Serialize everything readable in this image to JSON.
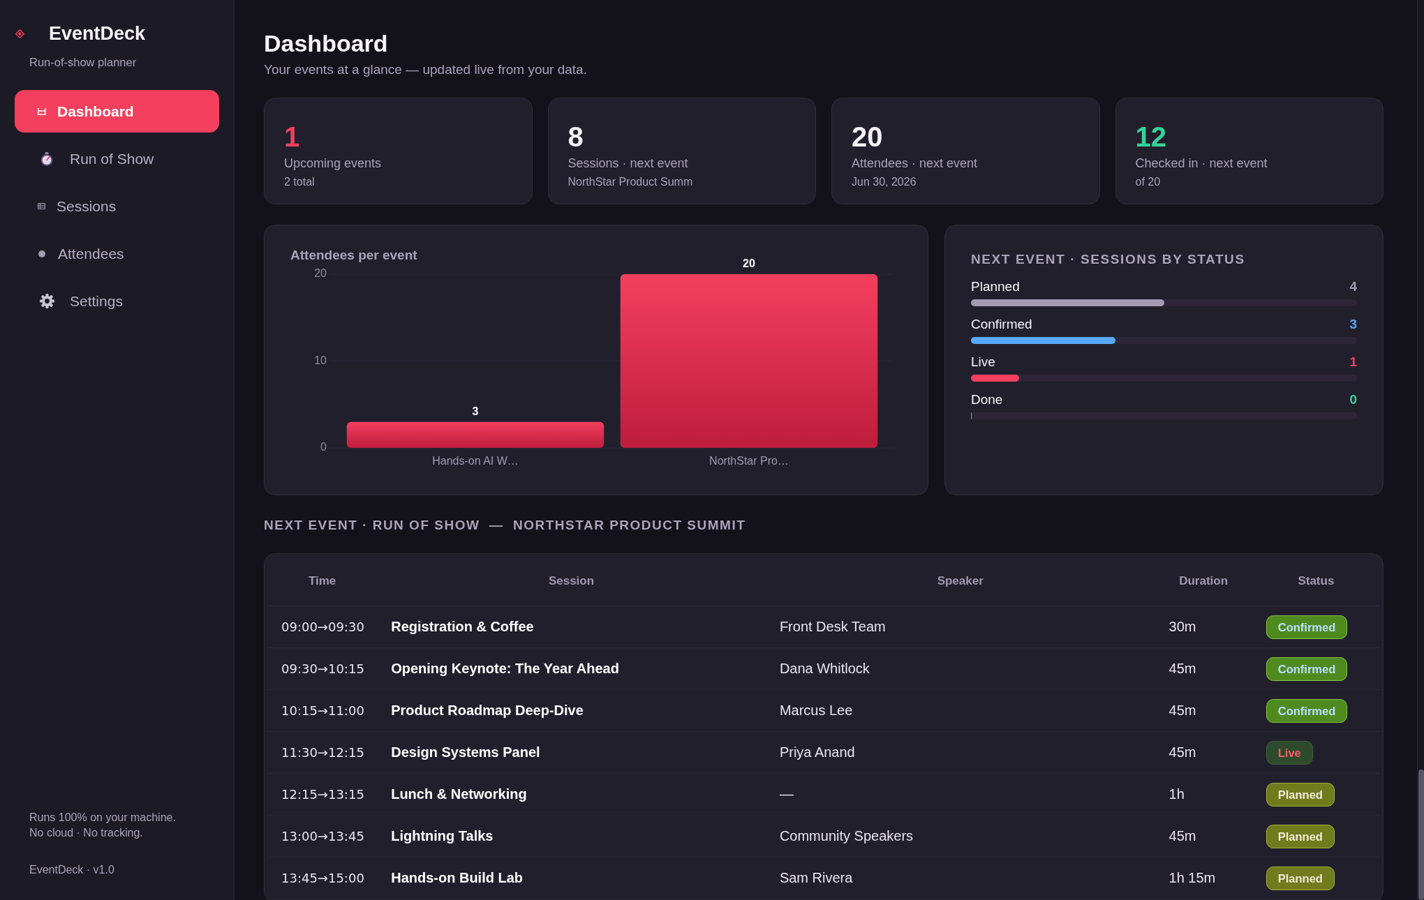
{
  "sidebar": {
    "brand": {
      "name": "EventDeck",
      "tagline": "Run-of-show planner"
    },
    "nav": [
      {
        "label": "Dashboard",
        "selected": true
      },
      {
        "label": "Run of Show",
        "selected": false
      },
      {
        "label": "Sessions",
        "selected": false
      },
      {
        "label": "Attendees",
        "selected": false
      },
      {
        "label": "Settings",
        "selected": false
      }
    ],
    "footer": {
      "note": [
        "Runs 100% on your machine.",
        "No cloud · No tracking."
      ],
      "version": "EventDeck · v1.0"
    }
  },
  "header": {
    "title": "Dashboard",
    "subtitle": "Your events at a glance — updated live from your data."
  },
  "stats": [
    {
      "value": "1",
      "color": "#f43f5e",
      "label": "Upcoming events",
      "detail": "2 total"
    },
    {
      "value": "8",
      "color": "#f4f2f8",
      "label": "Sessions · next event",
      "detail": "NorthStar Product Summ"
    },
    {
      "value": "20",
      "color": "#f4f2f8",
      "label": "Attendees · next event",
      "detail": "Jun 30, 2026"
    },
    {
      "value": "12",
      "color": "#34d399",
      "label": "Checked in · next event",
      "detail": "of 20"
    }
  ],
  "attendees_chart": {
    "chart_data": {
      "type": "bar",
      "title": "Attendees per event",
      "categories": [
        "Hands-on AI W…",
        "NorthStar Pro…"
      ],
      "values": [
        3,
        20
      ],
      "ylim": [
        0,
        20
      ],
      "yticks": [
        0,
        10,
        20
      ],
      "data_labels": true
    }
  },
  "status_panel": {
    "title": "NEXT EVENT · SESSIONS BY STATUS",
    "items": [
      {
        "label": "Planned",
        "count": "4",
        "level": 0.5,
        "color": "#a09ab3"
      },
      {
        "label": "Confirmed",
        "count": "3",
        "level": 0.375,
        "color": "#58a9f8"
      },
      {
        "label": "Live",
        "count": "1",
        "level": 0.125,
        "color": "#f43f5e"
      },
      {
        "label": "Done",
        "count": "0",
        "level": 0,
        "color": "#34d399"
      }
    ]
  },
  "run_of_show": {
    "heading": "NEXT EVENT · RUN OF SHOW  —  NORTHSTAR PRODUCT SUMMIT",
    "columns": [
      "Time",
      "Session",
      "Speaker",
      "Duration",
      "Status"
    ],
    "rows": [
      {
        "time": "09:00→09:30",
        "session": "Registration & Coffee",
        "speaker": "Front Desk Team",
        "duration": "30m",
        "status": {
          "label": "Confirmed",
          "kind": "confirmed"
        }
      },
      {
        "time": "09:30→10:15",
        "session": "Opening Keynote: The Year Ahead",
        "speaker": "Dana Whitlock",
        "duration": "45m",
        "status": {
          "label": "Confirmed",
          "kind": "confirmed"
        }
      },
      {
        "time": "10:15→11:00",
        "session": "Product Roadmap Deep-Dive",
        "speaker": "Marcus Lee",
        "duration": "45m",
        "status": {
          "label": "Confirmed",
          "kind": "confirmed"
        }
      },
      {
        "time": "11:30→12:15",
        "session": "Design Systems Panel",
        "speaker": "Priya Anand",
        "duration": "45m",
        "status": {
          "label": "Live",
          "kind": "live"
        }
      },
      {
        "time": "12:15→13:15",
        "session": "Lunch & Networking",
        "speaker": "—",
        "duration": "1h",
        "status": {
          "label": "Planned",
          "kind": "planned"
        }
      },
      {
        "time": "13:00→13:45",
        "session": "Lightning Talks",
        "speaker": "Community Speakers",
        "duration": "45m",
        "status": {
          "label": "Planned",
          "kind": "planned"
        }
      },
      {
        "time": "13:45→15:00",
        "session": "Hands-on Build Lab",
        "speaker": "Sam Rivera",
        "duration": "1h 15m",
        "status": {
          "label": "Planned",
          "kind": "planned"
        }
      }
    ]
  }
}
